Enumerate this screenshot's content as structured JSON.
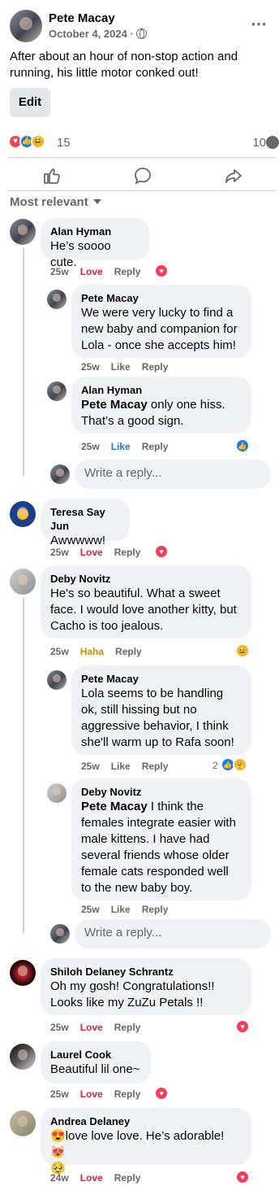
{
  "post": {
    "author": "Pete Macay",
    "date": "October 4, 2024 ·",
    "text": "After about an hour of non-stop action and running, his little motor conked out!",
    "edit_label": "Edit",
    "reaction_count": "15",
    "comment_count": "10",
    "more_icon": "⋯"
  },
  "sort_label": "Most relevant",
  "comments": [
    {
      "author": "Alan Hyman",
      "text": "He’s soooo cute.",
      "time": "25w",
      "reaction": "Love",
      "reply": "Reply"
    },
    {
      "author": "Pete Macay",
      "text": "We were very lucky to find a new baby and companion for Lola - once she accepts him!",
      "time": "25w",
      "reaction": "Like",
      "reply": "Reply"
    },
    {
      "author": "Alan Hyman",
      "mention": "Pete Macay",
      "text": " only one hiss. That’s a good sign.",
      "time": "25w",
      "reaction": "Like",
      "reply": "Reply"
    },
    {
      "author": "Teresa Say Jun",
      "text": "Awwwww!",
      "time": "25w",
      "reaction": "Love",
      "reply": "Reply"
    },
    {
      "author": "Deby Novitz",
      "text": "He's so beautiful. What a sweet face. I would love another kitty, but Cacho is too jealous.",
      "time": "25w",
      "reaction": "Haha",
      "reply": "Reply"
    },
    {
      "author": "Pete Macay",
      "text": "Lola seems to be handling ok, still hissing but no aggressive behavior, I think she'll warm up to Rafa soon!",
      "time": "25w",
      "reaction": "Like",
      "reply": "Reply",
      "badge_count": "2"
    },
    {
      "author": "Deby Novitz",
      "mention": "Pete Macay",
      "text": " I think the females integrate easier with male kittens. I have had several friends whose older female cats responded well to the new baby boy.",
      "time": "25w",
      "reaction": "Like",
      "reply": "Reply"
    },
    {
      "author": "Shiloh Delaney Schrantz",
      "text": "Oh my gosh! Congratulations!! Looks like my ZuZu Petals !!",
      "time": "25w",
      "reaction": "Love",
      "reply": "Reply"
    },
    {
      "author": "Laurel Cook",
      "text": "Beautiful lil one~",
      "time": "25w",
      "reaction": "Love",
      "reply": "Reply"
    },
    {
      "author": "Andrea Delaney",
      "text": "😍love love love. He’s adorable! 😻",
      "text2": "🥹",
      "time": "24w",
      "reaction": "Love",
      "reply": "Reply"
    }
  ],
  "reply_placeholder": "Write a reply...",
  "colors": {
    "love": "#e41e3f",
    "like": "#1877f2",
    "haha": "#c29100",
    "bubble": "#f0f2f5",
    "meta": "#65676b"
  }
}
